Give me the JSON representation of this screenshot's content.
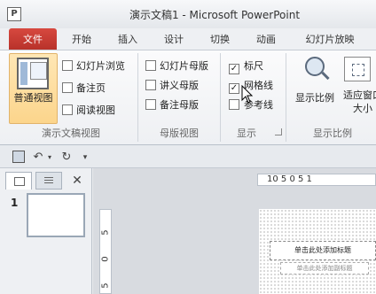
{
  "window": {
    "app_icon_letter": "P",
    "title": "演示文稿1 - Microsoft PowerPoint"
  },
  "tabs": [
    "文件",
    "开始",
    "插入",
    "设计",
    "切换",
    "动画",
    "幻灯片放映"
  ],
  "ribbon": {
    "presentation_views": {
      "normal": "普通视图",
      "slide_sorter": "幻灯片浏览",
      "notes_page": "备注页",
      "reading_view": "阅读视图",
      "group_label": "演示文稿视图"
    },
    "master_views": {
      "slide_master": "幻灯片母版",
      "handout_master": "讲义母版",
      "notes_master": "备注母版",
      "group_label": "母版视图"
    },
    "show": {
      "ruler": "标尺",
      "gridlines": "网格线",
      "guides": "参考线",
      "group_label": "显示",
      "ruler_checked": true,
      "gridlines_checked": true,
      "guides_checked": false
    },
    "zoom": {
      "zoom_label": "显示比例",
      "fit_label": "适应窗口大小",
      "group_label": "显示比例"
    }
  },
  "qat": {
    "undo": "↶",
    "redo": "↻"
  },
  "slides_panel": {
    "close": "✕",
    "slide_number": "1"
  },
  "ruler": {
    "horizontal": "10   5   0   5   1",
    "vertical": [
      "5",
      "0",
      "5"
    ]
  },
  "slide": {
    "title_placeholder": "单击此处添加标题",
    "subtitle_placeholder": "单击此处添加副标题"
  }
}
